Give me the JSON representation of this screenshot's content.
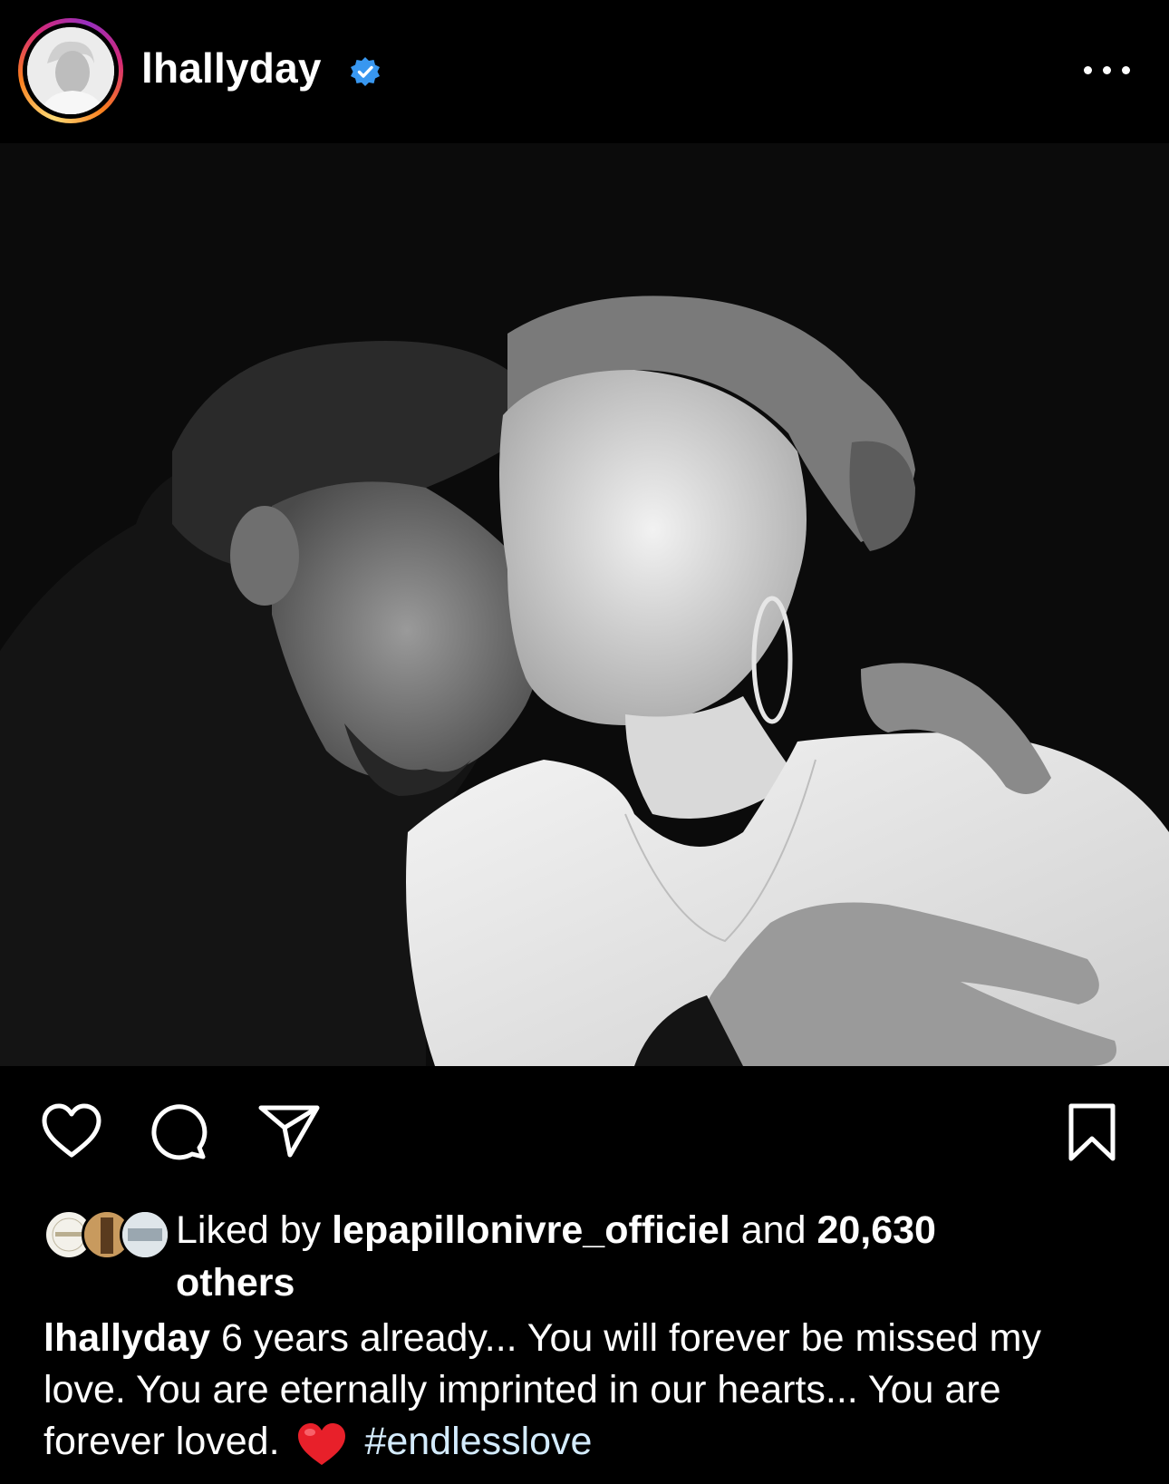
{
  "post": {
    "username": "lhallyday",
    "verified": true
  },
  "icons": {
    "like": "heart-outline-icon",
    "comment": "comment-bubble-icon",
    "share": "paper-plane-icon",
    "save": "bookmark-icon",
    "more": "more-horizontal-icon",
    "verified": "verified-badge-icon"
  },
  "likes": {
    "prefix": "Liked by ",
    "user": "lepapillonivre_officiel",
    "middle": " and ",
    "count": "20,630",
    "suffix": "others"
  },
  "caption": {
    "author": "lhallyday",
    "text": " 6 years already... You will forever be missed my love. You are eternally imprinted in our hearts... You are forever loved.",
    "hashtag": "#endlesslove"
  },
  "colors": {
    "background": "#000000",
    "verified_blue": "#3897f0",
    "heart_red": "#e8202a"
  }
}
